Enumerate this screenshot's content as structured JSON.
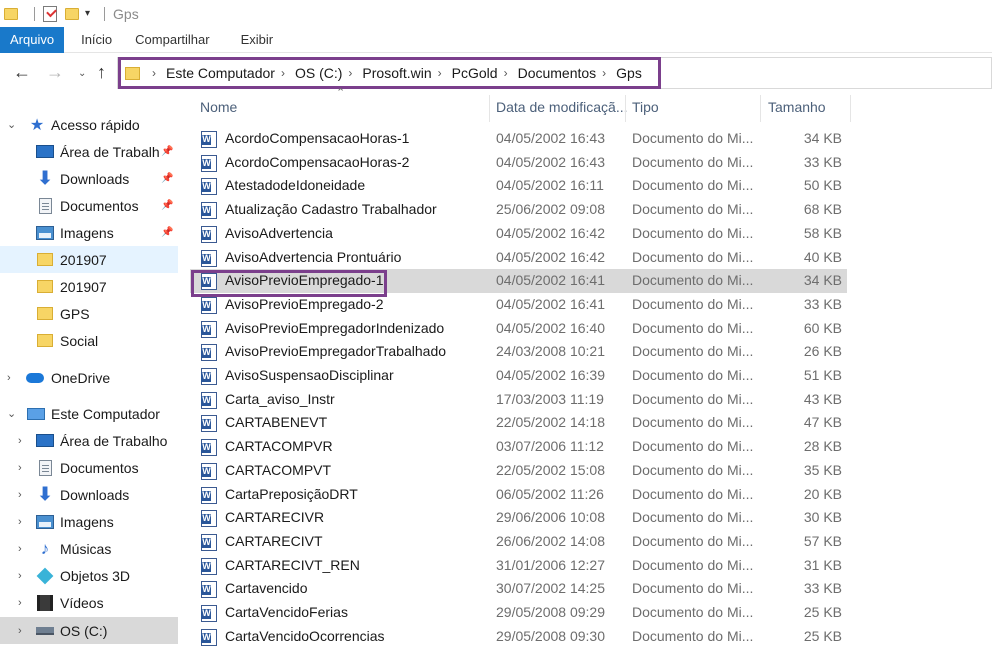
{
  "window": {
    "title": "Gps"
  },
  "ribbon": {
    "tabs": [
      "Arquivo",
      "Início",
      "Compartilhar",
      "Exibir"
    ]
  },
  "address": {
    "crumbs": [
      "Este Computador",
      "OS (C:)",
      "Prosoft.win",
      "PcGold",
      "Documentos",
      "Gps"
    ]
  },
  "sidebar": {
    "items": [
      {
        "label": "Acesso rápido",
        "icon": "quick-access-star-icon",
        "pinned": false
      },
      {
        "label": "Área de Trabalho",
        "icon": "desktop-icon",
        "pinned": true
      },
      {
        "label": "Downloads",
        "icon": "download-arrow-icon",
        "pinned": true
      },
      {
        "label": "Documentos",
        "icon": "document-icon",
        "pinned": true
      },
      {
        "label": "Imagens",
        "icon": "pictures-icon",
        "pinned": true
      },
      {
        "label": "201907",
        "icon": "folder-icon",
        "pinned": false
      },
      {
        "label": "201907",
        "icon": "folder-icon",
        "pinned": false
      },
      {
        "label": "GPS",
        "icon": "folder-icon",
        "pinned": false
      },
      {
        "label": "Social",
        "icon": "folder-icon",
        "pinned": false
      },
      {
        "label": "OneDrive",
        "icon": "onedrive-cloud-icon",
        "pinned": false
      },
      {
        "label": "Este Computador",
        "icon": "this-pc-icon",
        "pinned": false
      },
      {
        "label": "Área de Trabalho",
        "icon": "desktop-icon",
        "pinned": false
      },
      {
        "label": "Documentos",
        "icon": "document-icon",
        "pinned": false
      },
      {
        "label": "Downloads",
        "icon": "download-arrow-icon",
        "pinned": false
      },
      {
        "label": "Imagens",
        "icon": "pictures-icon",
        "pinned": false
      },
      {
        "label": "Músicas",
        "icon": "music-note-icon",
        "pinned": false
      },
      {
        "label": "Objetos 3D",
        "icon": "3d-objects-icon",
        "pinned": false
      },
      {
        "label": "Vídeos",
        "icon": "videos-icon",
        "pinned": false
      },
      {
        "label": "OS (C:)",
        "icon": "drive-icon",
        "pinned": false
      }
    ]
  },
  "columns": {
    "name": "Nome",
    "date": "Data de modificaçã...",
    "type": "Tipo",
    "size": "Tamanho"
  },
  "files": [
    {
      "name": "AcordoCompensacaoHoras-1",
      "date": "04/05/2002 16:43",
      "type": "Documento do Mi...",
      "size": "34 KB"
    },
    {
      "name": "AcordoCompensacaoHoras-2",
      "date": "04/05/2002 16:43",
      "type": "Documento do Mi...",
      "size": "33 KB"
    },
    {
      "name": "AtestadodeIdoneidade",
      "date": "04/05/2002 16:11",
      "type": "Documento do Mi...",
      "size": "50 KB"
    },
    {
      "name": "Atualização Cadastro Trabalhador",
      "date": "25/06/2002 09:08",
      "type": "Documento do Mi...",
      "size": "68 KB"
    },
    {
      "name": "AvisoAdvertencia",
      "date": "04/05/2002 16:42",
      "type": "Documento do Mi...",
      "size": "58 KB"
    },
    {
      "name": "AvisoAdvertencia Prontuário",
      "date": "04/05/2002 16:42",
      "type": "Documento do Mi...",
      "size": "40 KB"
    },
    {
      "name": "AvisoPrevioEmpregado-1",
      "date": "04/05/2002 16:41",
      "type": "Documento do Mi...",
      "size": "34 KB",
      "selected": true
    },
    {
      "name": "AvisoPrevioEmpregado-2",
      "date": "04/05/2002 16:41",
      "type": "Documento do Mi...",
      "size": "33 KB"
    },
    {
      "name": "AvisoPrevioEmpregadorIndenizado",
      "date": "04/05/2002 16:40",
      "type": "Documento do Mi...",
      "size": "60 KB"
    },
    {
      "name": "AvisoPrevioEmpregadorTrabalhado",
      "date": "24/03/2008 10:21",
      "type": "Documento do Mi...",
      "size": "26 KB"
    },
    {
      "name": "AvisoSuspensaoDisciplinar",
      "date": "04/05/2002 16:39",
      "type": "Documento do Mi...",
      "size": "51 KB"
    },
    {
      "name": "Carta_aviso_Instr",
      "date": "17/03/2003 11:19",
      "type": "Documento do Mi...",
      "size": "43 KB"
    },
    {
      "name": "CARTABENEVT",
      "date": "22/05/2002 14:18",
      "type": "Documento do Mi...",
      "size": "47 KB"
    },
    {
      "name": "CARTACOMPVR",
      "date": "03/07/2006 11:12",
      "type": "Documento do Mi...",
      "size": "28 KB"
    },
    {
      "name": "CARTACOMPVT",
      "date": "22/05/2002 15:08",
      "type": "Documento do Mi...",
      "size": "35 KB"
    },
    {
      "name": "CartaPreposiçãoDRT",
      "date": "06/05/2002 11:26",
      "type": "Documento do Mi...",
      "size": "20 KB"
    },
    {
      "name": "CARTARECIVR",
      "date": "29/06/2006 10:08",
      "type": "Documento do Mi...",
      "size": "30 KB"
    },
    {
      "name": "CARTARECIVT",
      "date": "26/06/2002 14:08",
      "type": "Documento do Mi...",
      "size": "57 KB"
    },
    {
      "name": "CARTARECIVT_REN",
      "date": "31/01/2006 12:27",
      "type": "Documento do Mi...",
      "size": "31 KB"
    },
    {
      "name": "Cartavencido",
      "date": "30/07/2002 14:25",
      "type": "Documento do Mi...",
      "size": "33 KB"
    },
    {
      "name": "CartaVencidoFerias",
      "date": "29/05/2008 09:29",
      "type": "Documento do Mi...",
      "size": "25 KB"
    },
    {
      "name": "CartaVencidoOcorrencias",
      "date": "29/05/2008 09:30",
      "type": "Documento do Mi...",
      "size": "25 KB"
    }
  ],
  "colors": {
    "accent": "#1979ca",
    "highlight_border": "#7b3f8c",
    "selected_row": "#d9d9d9"
  }
}
